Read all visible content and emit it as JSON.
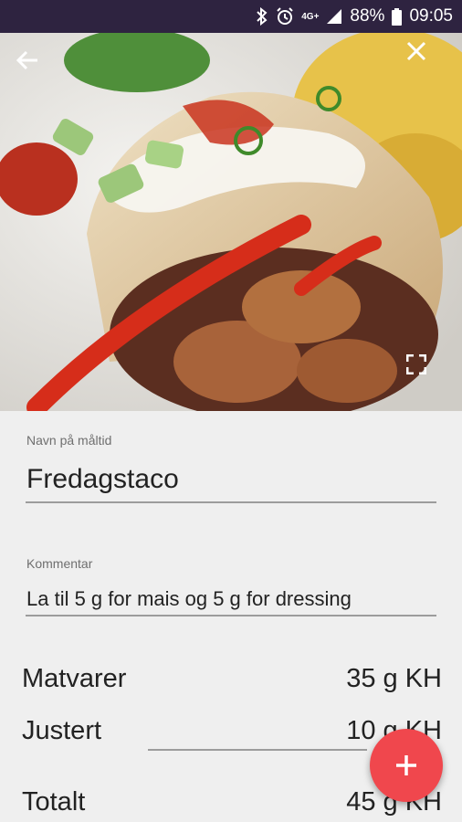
{
  "status_bar": {
    "network": "4G+",
    "battery": "88%",
    "time": "09:05"
  },
  "header": {
    "back_icon": "arrow-back-icon",
    "close_icon": "close-icon",
    "fullscreen_icon": "fullscreen-icon"
  },
  "form": {
    "meal_name_label": "Navn på måltid",
    "meal_name_value": "Fredagstaco",
    "comment_label": "Kommentar",
    "comment_value": "La til 5 g for mais og 5 g for dressing"
  },
  "summary": {
    "rows": [
      {
        "label": "Matvarer",
        "value": "35 g KH"
      },
      {
        "label": "Justert",
        "value": "10 g KH"
      },
      {
        "label": "Totalt",
        "value": "45 g KH"
      }
    ]
  },
  "fab": {
    "icon": "plus-icon"
  },
  "colors": {
    "status_bar": "#2e2340",
    "accent": "#f0474d",
    "background": "#efefef"
  }
}
